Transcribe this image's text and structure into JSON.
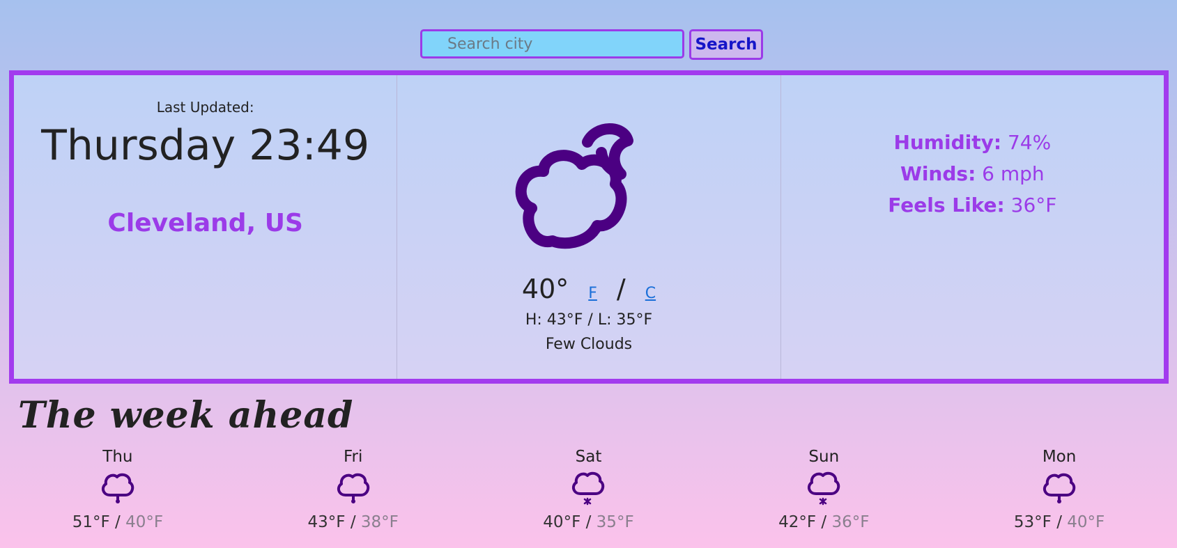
{
  "search": {
    "placeholder": "Search city",
    "button_label": "Search"
  },
  "current": {
    "last_updated_label": "Last Updated:",
    "datetime": "Thursday 23:49",
    "location": "Cleveland, US",
    "icon": "cloud-moon-icon",
    "temperature": "40°",
    "unit_f": "F",
    "unit_separator": "/",
    "unit_c": "C",
    "hilo": "H: 43°F / L: 35°F",
    "description": "Few Clouds",
    "humidity_label": "Humidity:",
    "humidity_value": "74%",
    "winds_label": "Winds:",
    "winds_value": "6 mph",
    "feels_like_label": "Feels Like:",
    "feels_like_value": "36°F"
  },
  "week": {
    "title": "The week ahead",
    "days": [
      {
        "name": "Thu",
        "icon": "rain-cloud-icon",
        "high": "51°F",
        "low": "40°F"
      },
      {
        "name": "Fri",
        "icon": "rain-cloud-icon",
        "high": "43°F",
        "low": "38°F"
      },
      {
        "name": "Sat",
        "icon": "snow-cloud-icon",
        "high": "40°F",
        "low": "35°F"
      },
      {
        "name": "Sun",
        "icon": "snow-cloud-icon",
        "high": "42°F",
        "low": "36°F"
      },
      {
        "name": "Mon",
        "icon": "rain-cloud-icon",
        "high": "53°F",
        "low": "40°F"
      }
    ],
    "separator": "/"
  },
  "colors": {
    "accent": "#9b3be8",
    "icon": "#4b0082",
    "link": "#1a6fd8",
    "search_bg": "#81d4fa"
  }
}
